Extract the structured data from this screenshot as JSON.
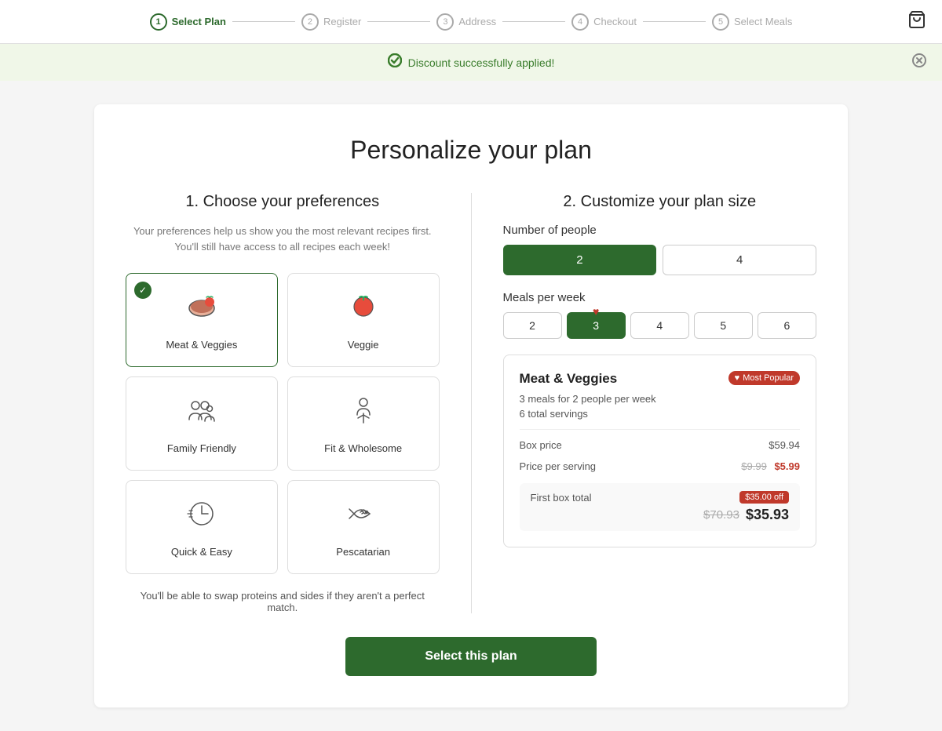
{
  "nav": {
    "steps": [
      {
        "number": "1",
        "label": "Select Plan",
        "active": true
      },
      {
        "number": "2",
        "label": "Register",
        "active": false
      },
      {
        "number": "3",
        "label": "Address",
        "active": false
      },
      {
        "number": "4",
        "label": "Checkout",
        "active": false
      },
      {
        "number": "5",
        "label": "Select Meals",
        "active": false
      }
    ],
    "cart_icon": "🛒"
  },
  "banner": {
    "message": "Discount successfully applied!",
    "icon": "✓"
  },
  "page": {
    "title": "Personalize your plan",
    "left_section_title": "1. Choose your preferences",
    "left_section_desc": "Your preferences help us show you the most relevant recipes first. You'll still have access to all recipes each week!",
    "right_section_title": "2. Customize your plan size"
  },
  "preferences": [
    {
      "id": "meat-veggies",
      "label": "Meat & Veggies",
      "selected": true
    },
    {
      "id": "veggie",
      "label": "Veggie",
      "selected": false
    },
    {
      "id": "family-friendly",
      "label": "Family Friendly",
      "selected": false
    },
    {
      "id": "fit-wholesome",
      "label": "Fit & Wholesome",
      "selected": false
    },
    {
      "id": "quick-easy",
      "label": "Quick & Easy",
      "selected": false
    },
    {
      "id": "pescatarian",
      "label": "Pescatarian",
      "selected": false
    }
  ],
  "swap_note": "You'll be able to swap proteins and sides if they aren't a perfect match.",
  "people_options": [
    "2",
    "4"
  ],
  "selected_people": "2",
  "meals_options": [
    "2",
    "3",
    "4",
    "5",
    "6"
  ],
  "selected_meals": "3",
  "popular_meals": "3",
  "summary": {
    "plan_name": "Meat & Veggies",
    "most_popular_label": "Most Popular",
    "meals_desc": "3 meals for 2 people per week",
    "servings_desc": "6 total servings",
    "box_price_label": "Box price",
    "box_price": "$59.94",
    "price_per_serving_label": "Price per serving",
    "price_per_serving_orig": "$9.99",
    "price_per_serving_new": "$5.99",
    "first_box_label": "First box total",
    "discount_badge": "$35.00 off",
    "first_box_orig": "$70.93",
    "first_box_final": "$35.93"
  },
  "button_label": "Select this plan",
  "colors": {
    "green": "#2d6a2d",
    "red": "#c0392b"
  }
}
